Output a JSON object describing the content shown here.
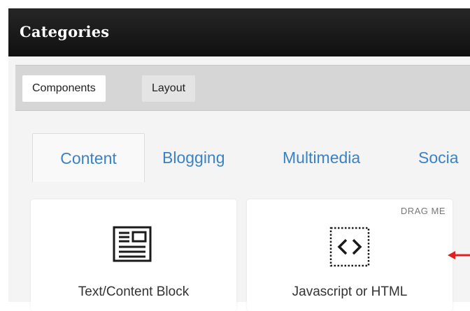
{
  "header": {
    "title": "Categories"
  },
  "toolbar": {
    "buttons": [
      {
        "label": "Components"
      },
      {
        "label": "Layout"
      }
    ]
  },
  "tabs": [
    {
      "label": "Content"
    },
    {
      "label": "Blogging"
    },
    {
      "label": "Multimedia"
    },
    {
      "label": "Socia"
    }
  ],
  "cards": [
    {
      "label": "Text/Content Block",
      "icon": "document-icon"
    },
    {
      "label": "Javascript or HTML",
      "icon": "code-icon",
      "badge": "DRAG ME"
    }
  ],
  "colors": {
    "accent": "#3b82c4",
    "arrow": "#e02020",
    "header_bg": "#1a1a1a"
  }
}
